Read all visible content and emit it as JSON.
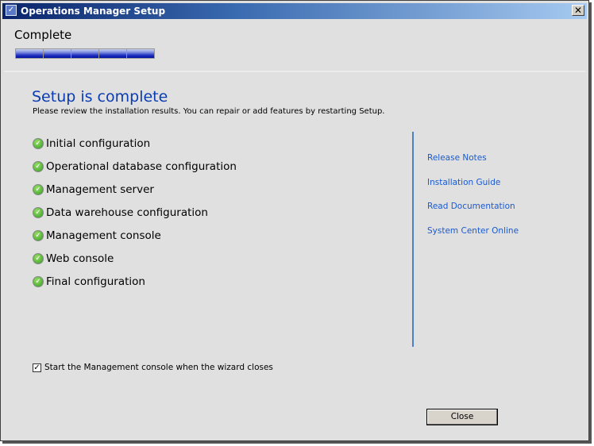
{
  "window": {
    "title": "Operations Manager Setup",
    "close_glyph": "✕"
  },
  "step": {
    "title": "Complete",
    "progress_segments_filled": 5,
    "progress_segments_total": 5
  },
  "main": {
    "heading": "Setup is complete",
    "subtitle": "Please review the installation results.  You can repair or add features by restarting Setup.",
    "items": [
      {
        "label": "Initial configuration",
        "status": "success"
      },
      {
        "label": "Operational database configuration",
        "status": "success"
      },
      {
        "label": "Management server",
        "status": "success"
      },
      {
        "label": "Data warehouse configuration",
        "status": "success"
      },
      {
        "label": "Management console",
        "status": "success"
      },
      {
        "label": "Web console",
        "status": "success"
      },
      {
        "label": "Final configuration",
        "status": "success"
      }
    ]
  },
  "links": [
    "Release Notes",
    "Installation Guide",
    "Read Documentation",
    "System Center Online"
  ],
  "checkbox": {
    "label": "Start the Management console when the wizard closes",
    "checked": true
  },
  "buttons": {
    "close": "Close"
  },
  "colors": {
    "accent": "#0a3cb4",
    "link": "#1a5ad0",
    "divider": "#4a80c8"
  }
}
